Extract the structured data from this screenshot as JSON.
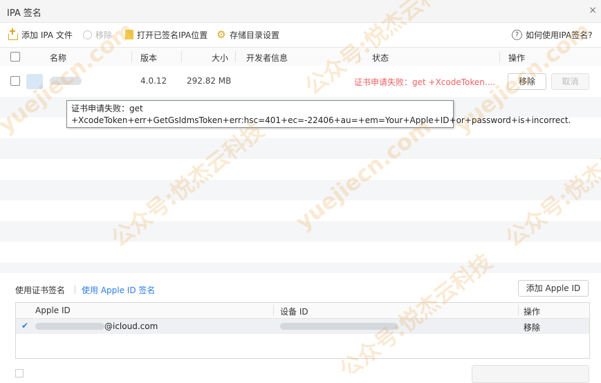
{
  "window": {
    "title": "IPA 签名",
    "close_glyph": "×"
  },
  "toolbar": {
    "add_ipa": "添加 IPA 文件",
    "remove": "移除",
    "open_signed_location": "打开已签名IPA位置",
    "storage_settings": "存储目录设置",
    "help": "如何使用IPA签名?"
  },
  "table": {
    "headers": {
      "name": "名称",
      "version": "版本",
      "size": "大小",
      "developer": "开发者信息",
      "status": "状态",
      "actions": "操作"
    },
    "rows": [
      {
        "version": "4.0.12",
        "size": "292.82 MB",
        "developer": "",
        "status": "证书申请失败：get +XcodeToken....",
        "remove_label": "移除",
        "cancel_label": "取消"
      }
    ]
  },
  "tooltip": {
    "text": "证书申请失败：get +XcodeToken+err+GetGsIdmsToken+err:hsc=401+ec=-22406+au=+em=Your+Apple+ID+or+password+is+incorrect."
  },
  "signing": {
    "tab_cert": "使用证书签名",
    "tab_apple_id": "使用 Apple ID 签名",
    "add_apple_id": "添加 Apple ID",
    "headers": {
      "apple_id": "Apple ID",
      "device_id": "设备 ID",
      "actions": "操作"
    },
    "rows": [
      {
        "apple_id_suffix": "@icloud.com",
        "action": "移除",
        "selected": true
      }
    ]
  },
  "watermarks": [
    "yuejiecn.com",
    "公众号:悦杰云科技"
  ],
  "colors": {
    "accent": "#2b7de9",
    "error": "#f06060",
    "icon_gold": "#d9a520"
  }
}
